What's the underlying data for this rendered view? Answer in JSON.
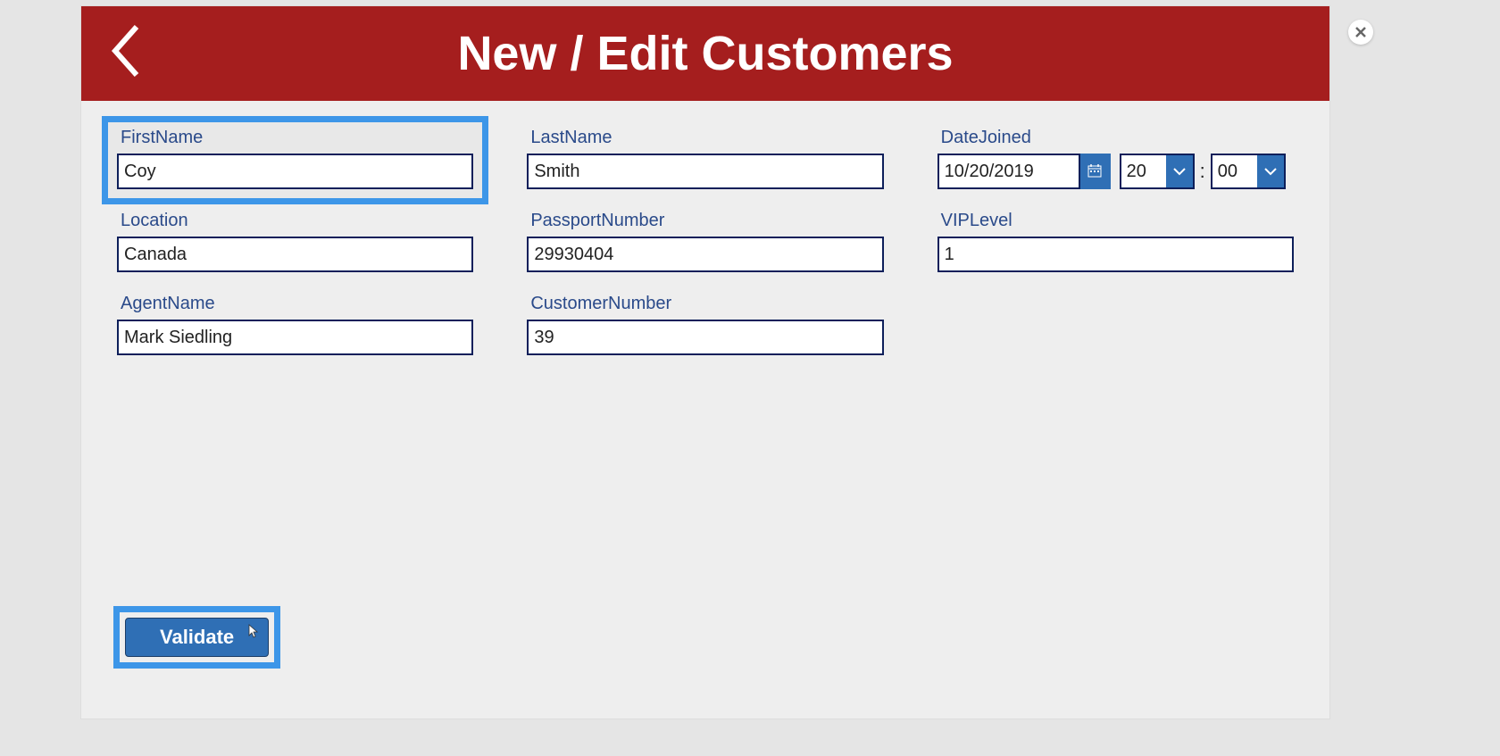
{
  "header": {
    "title": "New / Edit Customers"
  },
  "fields": {
    "firstName": {
      "label": "FirstName",
      "value": "Coy"
    },
    "lastName": {
      "label": "LastName",
      "value": "Smith"
    },
    "dateJoined": {
      "label": "DateJoined",
      "date": "10/20/2019",
      "hour": "20",
      "minute": "00"
    },
    "location": {
      "label": "Location",
      "value": "Canada"
    },
    "passportNumber": {
      "label": "PassportNumber",
      "value": "29930404"
    },
    "vipLevel": {
      "label": "VIPLevel",
      "value": "1"
    },
    "agentName": {
      "label": "AgentName",
      "value": "Mark Siedling"
    },
    "customerNumber": {
      "label": "CustomerNumber",
      "value": "39"
    }
  },
  "buttons": {
    "validate": "Validate"
  }
}
